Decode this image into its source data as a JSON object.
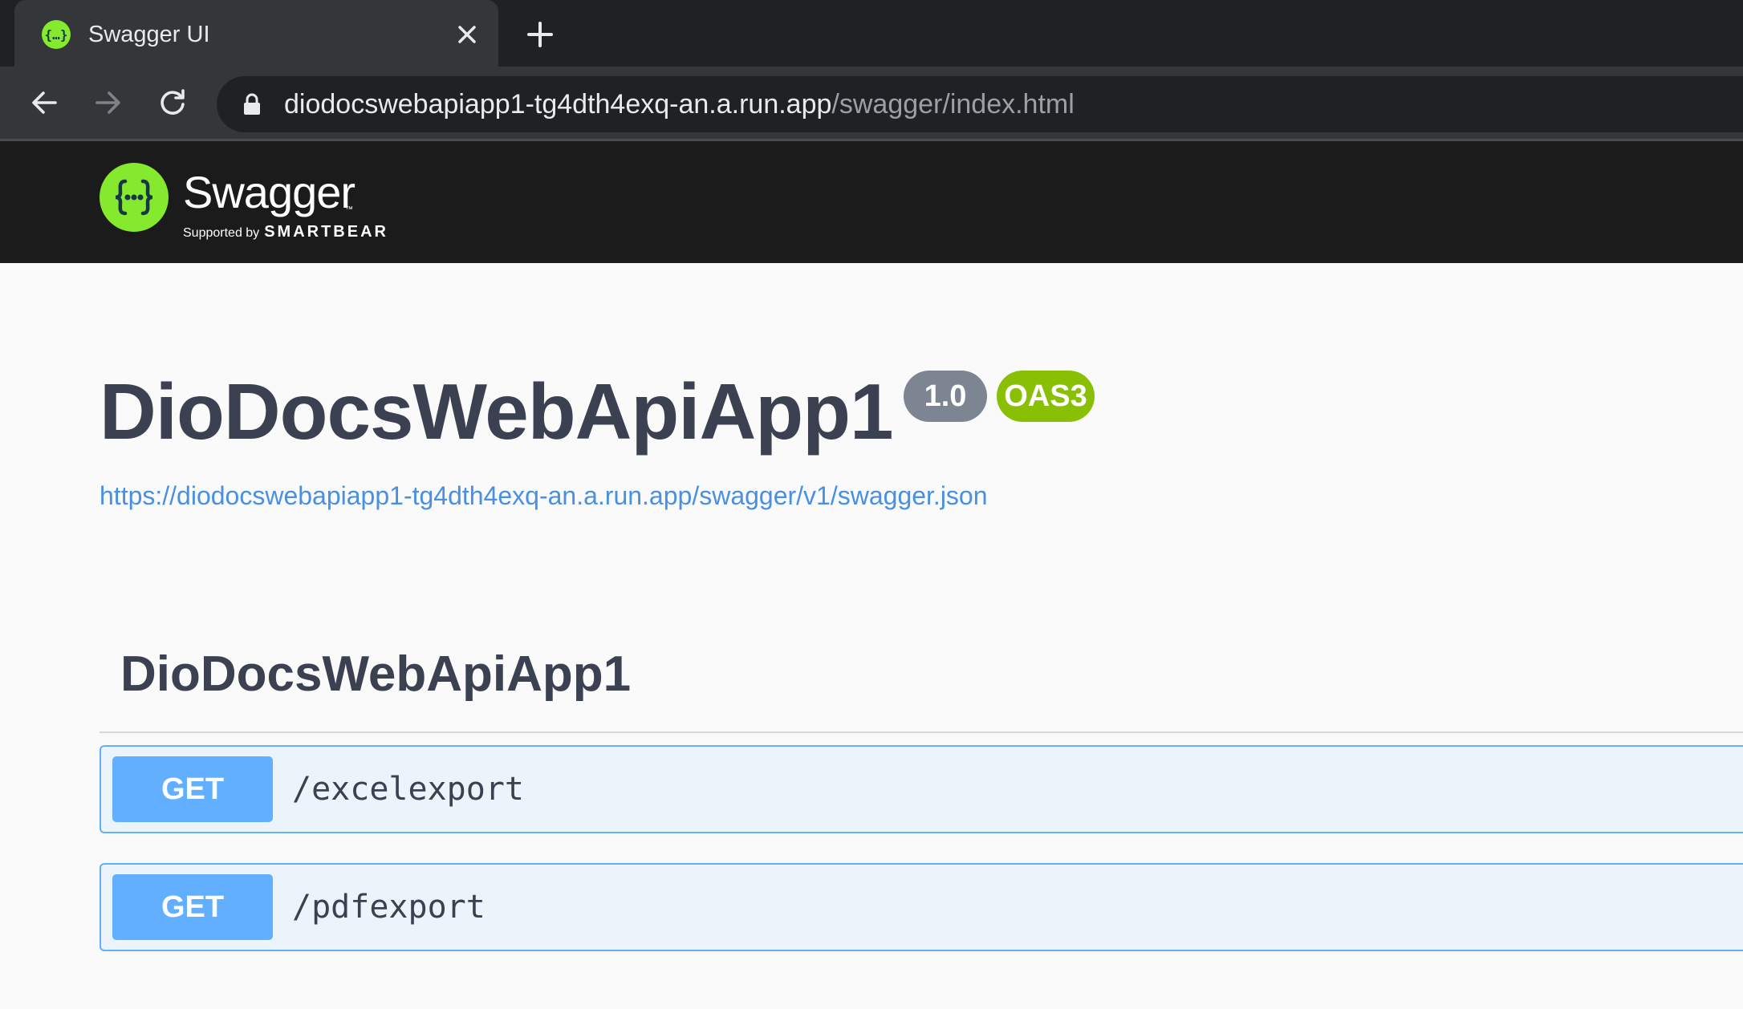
{
  "browser": {
    "tab": {
      "title": "Swagger UI",
      "favicon_icon": "swagger-favicon",
      "close_icon": "close-icon"
    },
    "new_tab_icon": "plus-icon",
    "nav": {
      "back_icon": "arrow-left-icon",
      "forward_icon": "arrow-right-icon",
      "reload_icon": "reload-icon"
    },
    "address": {
      "lock_icon": "lock-icon",
      "host": "diodocswebapiapp1-tg4dth4exq-an.a.run.app",
      "path": "/swagger/index.html"
    }
  },
  "topbar": {
    "logo_icon": "swagger-logo-icon",
    "brand": "Swagger",
    "trademark": "™",
    "supported_by": "Supported by",
    "company": "SMARTBEAR"
  },
  "info": {
    "title": "DioDocsWebApiApp1",
    "version_badge": "1.0",
    "oas_badge": "OAS3",
    "spec_url": "https://diodocswebapiapp1-tg4dth4exq-an.a.run.app/swagger/v1/swagger.json"
  },
  "tag": {
    "name": "DioDocsWebApiApp1"
  },
  "operations": [
    {
      "method": "GET",
      "path": "/excelexport"
    },
    {
      "method": "GET",
      "path": "/pdfexport"
    }
  ],
  "colors": {
    "get_method": "#61affe",
    "get_block_bg": "#ebf3fb",
    "oas_badge": "#89bf04",
    "version_badge": "#7d8492",
    "link": "#4990e2",
    "swagger_green": "#85ea2d"
  }
}
